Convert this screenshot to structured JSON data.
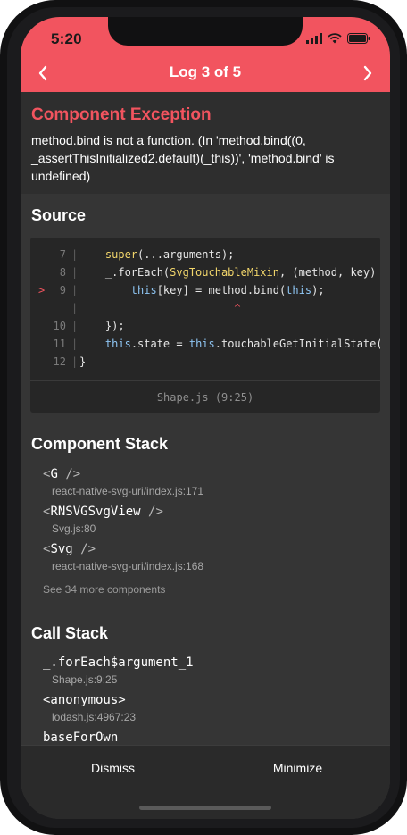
{
  "status_bar": {
    "time": "5:20"
  },
  "header": {
    "title": "Log 3 of 5",
    "prev_icon": "chevron-left-icon",
    "next_icon": "chevron-right-icon"
  },
  "exception": {
    "title": "Component Exception",
    "message": "method.bind is not a function. (In 'method.bind((0, _assertThisInitialized2.default)(_this))', 'method.bind' is undefined)"
  },
  "source": {
    "heading": "Source",
    "file": "Shape.js (9:25)",
    "lines": [
      {
        "marker": "",
        "num": "7",
        "pipe": "|",
        "parts": [
          {
            "t": "    "
          },
          {
            "t": "super",
            "c": "kw-super"
          },
          {
            "t": "(...arguments);"
          }
        ]
      },
      {
        "marker": "",
        "num": "8",
        "pipe": "|",
        "parts": [
          {
            "t": "    _.forEach("
          },
          {
            "t": "SvgTouchableMixin",
            "c": "kw-class"
          },
          {
            "t": ", (method, key) => {"
          }
        ]
      },
      {
        "marker": ">",
        "num": "9",
        "pipe": "|",
        "parts": [
          {
            "t": "        "
          },
          {
            "t": "this",
            "c": "kw-this"
          },
          {
            "t": "[key] = method.bind("
          },
          {
            "t": "this",
            "c": "kw-this"
          },
          {
            "t": ");"
          }
        ]
      },
      {
        "marker": "",
        "num": "",
        "pipe": "|",
        "parts": [
          {
            "t": "                        "
          },
          {
            "t": "^",
            "c": "caret"
          }
        ]
      },
      {
        "marker": "",
        "num": "10",
        "pipe": "|",
        "parts": [
          {
            "t": "    });"
          }
        ]
      },
      {
        "marker": "",
        "num": "11",
        "pipe": "|",
        "parts": [
          {
            "t": "    "
          },
          {
            "t": "this",
            "c": "kw-this"
          },
          {
            "t": ".state = "
          },
          {
            "t": "this",
            "c": "kw-this"
          },
          {
            "t": ".touchableGetInitialState();"
          }
        ]
      },
      {
        "marker": "",
        "num": "12",
        "pipe": "|",
        "parts": [
          {
            "t": "}"
          }
        ]
      }
    ]
  },
  "component_stack": {
    "heading": "Component Stack",
    "items": [
      {
        "name": "G",
        "file": "react-native-svg-uri/index.js:171"
      },
      {
        "name": "RNSVGSvgView",
        "file": "Svg.js:80"
      },
      {
        "name": "Svg",
        "file": "react-native-svg-uri/index.js:168"
      }
    ],
    "more": "See 34 more components"
  },
  "call_stack": {
    "heading": "Call Stack",
    "items": [
      {
        "name": "_.forEach$argument_1",
        "file": "Shape.js:9:25"
      },
      {
        "name": "<anonymous>",
        "file": "lodash.js:4967:23"
      },
      {
        "name": "baseForOwn",
        "file": ""
      }
    ]
  },
  "footer": {
    "dismiss": "Dismiss",
    "minimize": "Minimize"
  },
  "colors": {
    "accent": "#f2545f",
    "background": "#353535",
    "code_bg": "#262626"
  }
}
